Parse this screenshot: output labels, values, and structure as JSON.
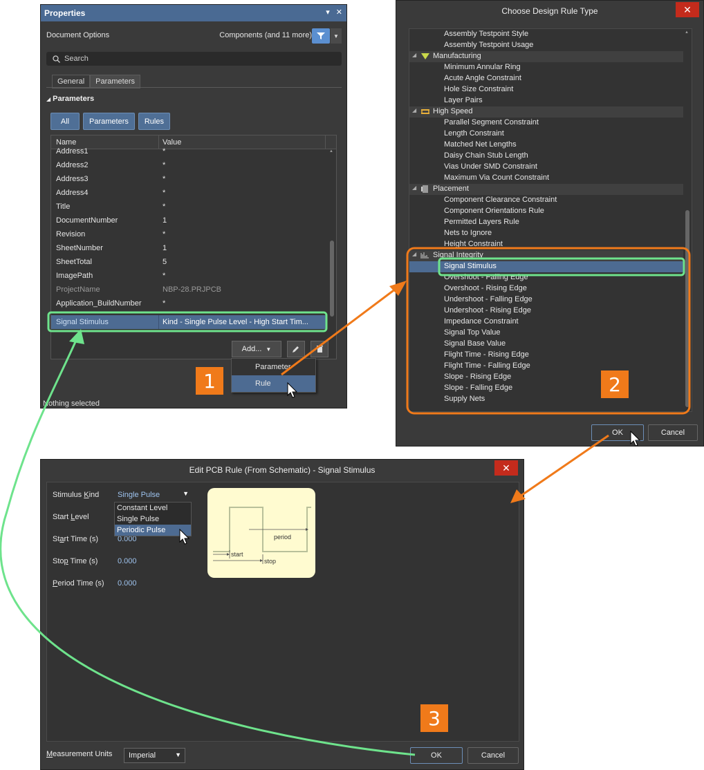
{
  "colors": {
    "accent": "#4d6b92",
    "badge": "#f07a1a",
    "arrow_orange": "#f07a1a",
    "arrow_green": "#6ee38c",
    "highlight_green": "#6ee38c"
  },
  "properties": {
    "title": "Properties",
    "doc_options": "Document Options",
    "components": "Components (and 11 more)",
    "search_placeholder": "Search",
    "tabs": [
      "General",
      "Parameters"
    ],
    "section": "Parameters",
    "filters": [
      "All",
      "Parameters",
      "Rules"
    ],
    "col_name": "Name",
    "col_value": "Value",
    "rows": [
      {
        "name": "Address1",
        "value": "*"
      },
      {
        "name": "Address2",
        "value": "*"
      },
      {
        "name": "Address3",
        "value": "*"
      },
      {
        "name": "Address4",
        "value": "*"
      },
      {
        "name": "Title",
        "value": "*"
      },
      {
        "name": "DocumentNumber",
        "value": "1"
      },
      {
        "name": "Revision",
        "value": "*"
      },
      {
        "name": "SheetNumber",
        "value": "1"
      },
      {
        "name": "SheetTotal",
        "value": "5"
      },
      {
        "name": "ImagePath",
        "value": "*"
      },
      {
        "name": "ProjectName",
        "value": "NBP-28.PRJPCB"
      },
      {
        "name": "Application_BuildNumber",
        "value": "*"
      }
    ],
    "rule_row": {
      "name": "Signal Stimulus",
      "value": "Kind - Single Pulse    Level - High    Start Tim..."
    },
    "add_button": "Add...",
    "menu": [
      "Parameter",
      "Rule"
    ],
    "status": "Nothing selected"
  },
  "badges": [
    "1",
    "2",
    "3"
  ],
  "choose": {
    "title": "Choose Design Rule Type",
    "tree": [
      {
        "type": "item",
        "label": "Assembly Testpoint Style"
      },
      {
        "type": "item",
        "label": "Assembly Testpoint Usage"
      },
      {
        "type": "cat",
        "label": "Manufacturing",
        "icon": "manufacturing-icon"
      },
      {
        "type": "item",
        "label": "Minimum Annular Ring"
      },
      {
        "type": "item",
        "label": "Acute Angle Constraint"
      },
      {
        "type": "item",
        "label": "Hole Size Constraint"
      },
      {
        "type": "item",
        "label": "Layer Pairs"
      },
      {
        "type": "cat",
        "label": "High Speed",
        "icon": "high-speed-icon"
      },
      {
        "type": "item",
        "label": "Parallel Segment Constraint"
      },
      {
        "type": "item",
        "label": "Length Constraint"
      },
      {
        "type": "item",
        "label": "Matched Net Lengths"
      },
      {
        "type": "item",
        "label": "Daisy Chain Stub Length"
      },
      {
        "type": "item",
        "label": "Vias Under SMD Constraint"
      },
      {
        "type": "item",
        "label": "Maximum Via Count Constraint"
      },
      {
        "type": "cat",
        "label": "Placement",
        "icon": "placement-icon"
      },
      {
        "type": "item",
        "label": "Component Clearance Constraint"
      },
      {
        "type": "item",
        "label": "Component Orientations Rule"
      },
      {
        "type": "item",
        "label": "Permitted Layers Rule"
      },
      {
        "type": "item",
        "label": "Nets to Ignore"
      },
      {
        "type": "item",
        "label": "Height Constraint"
      },
      {
        "type": "cat",
        "label": "Signal Integrity",
        "icon": "signal-integrity-icon"
      },
      {
        "type": "item",
        "label": "Signal Stimulus",
        "selected": true
      },
      {
        "type": "item",
        "label": "Overshoot - Falling Edge"
      },
      {
        "type": "item",
        "label": "Overshoot - Rising Edge"
      },
      {
        "type": "item",
        "label": "Undershoot - Falling Edge"
      },
      {
        "type": "item",
        "label": "Undershoot - Rising Edge"
      },
      {
        "type": "item",
        "label": "Impedance Constraint"
      },
      {
        "type": "item",
        "label": "Signal Top Value"
      },
      {
        "type": "item",
        "label": "Signal Base Value"
      },
      {
        "type": "item",
        "label": "Flight Time - Rising Edge"
      },
      {
        "type": "item",
        "label": "Flight Time - Falling Edge"
      },
      {
        "type": "item",
        "label": "Slope - Rising Edge"
      },
      {
        "type": "item",
        "label": "Slope - Falling Edge"
      },
      {
        "type": "item",
        "label": "Supply Nets"
      }
    ],
    "ok": "OK",
    "cancel": "Cancel"
  },
  "edit": {
    "title": "Edit PCB Rule (From Schematic) - Signal Stimulus",
    "stimulus_kind": {
      "pre": "Stimulus ",
      "u": "K",
      "post": "ind"
    },
    "kind_value": "Single Pulse",
    "kind_options": [
      "Constant Level",
      "Single Pulse",
      "Periodic Pulse"
    ],
    "start_level": {
      "pre": "Start ",
      "u": "L",
      "post": "evel"
    },
    "start_time": {
      "pre": "St",
      "u": "a",
      "post": "rt Time (s)"
    },
    "start_time_value": "0.000",
    "stop_time": {
      "pre": "Sto",
      "u": "p",
      "post": " Time (s)"
    },
    "stop_time_value": "0.000",
    "period_time": {
      "pre": "",
      "u": "P",
      "post": "eriod Time (s)"
    },
    "period_time_value": "0.000",
    "wave_labels": {
      "period": "period",
      "start": "start",
      "stop": "stop"
    },
    "units_label": {
      "pre": "",
      "u": "M",
      "post": "easurement Units"
    },
    "units_value": "Imperial",
    "ok": "OK",
    "cancel": "Cancel"
  }
}
